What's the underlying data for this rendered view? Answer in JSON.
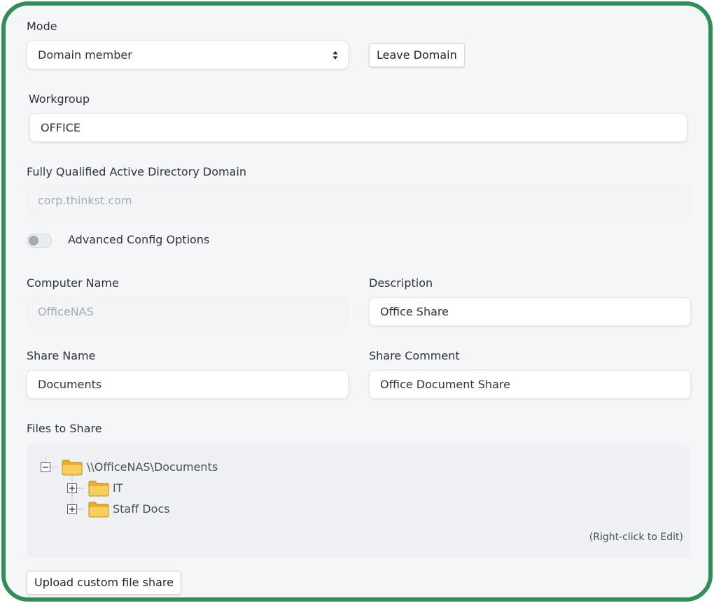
{
  "mode": {
    "label": "Mode",
    "selected": "Domain member",
    "leave_button": "Leave Domain"
  },
  "workgroup": {
    "label": "Workgroup",
    "value": "OFFICE"
  },
  "ad_domain": {
    "label": "Fully Qualified Active Directory Domain",
    "placeholder": "corp.thinkst.com"
  },
  "advanced": {
    "label": "Advanced Config Options",
    "enabled": false
  },
  "computer_name": {
    "label": "Computer Name",
    "placeholder": "OfficeNAS"
  },
  "description": {
    "label": "Description",
    "value": "Office Share"
  },
  "share_name": {
    "label": "Share Name",
    "value": "Documents"
  },
  "share_comment": {
    "label": "Share Comment",
    "value": "Office Document Share"
  },
  "files": {
    "label": "Files to Share",
    "root": "\\\\OfficeNAS\\Documents",
    "children": [
      "IT",
      "Staff Docs"
    ],
    "hint": "(Right-click to Edit)"
  },
  "upload_button": "Upload custom file share",
  "colors": {
    "border": "#2f8f57",
    "folder": "#f2c14e"
  },
  "icons": {
    "tree_collapse": "minus-box-icon",
    "tree_expand": "plus-box-icon",
    "folder": "folder-icon",
    "select_caret": "up-down-caret-icon"
  }
}
